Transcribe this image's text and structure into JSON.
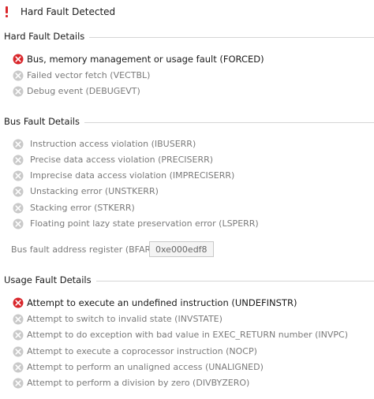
{
  "title": "Hard Fault Detected",
  "colors": {
    "error_red": "#d9262b",
    "disabled_gray": "#c9c9c9",
    "text_dark": "#1a1a1a",
    "text_gray": "#7a7a7a"
  },
  "sections": {
    "hard": {
      "title": "Hard Fault Details",
      "items": [
        {
          "label": "Bus, memory management or usage fault (FORCED)",
          "active": true,
          "icon": "error-icon"
        },
        {
          "label": "Failed vector fetch (VECTBL)",
          "active": false,
          "icon": "error-icon"
        },
        {
          "label": "Debug event (DEBUGEVT)",
          "active": false,
          "icon": "error-icon"
        }
      ]
    },
    "bus": {
      "title": "Bus Fault Details",
      "items": [
        {
          "label": "Instruction access violation (IBUSERR)",
          "active": false,
          "icon": "error-icon"
        },
        {
          "label": "Precise data access violation (PRECISERR)",
          "active": false,
          "icon": "error-icon"
        },
        {
          "label": "Imprecise data access violation (IMPRECISERR)",
          "active": false,
          "icon": "error-icon"
        },
        {
          "label": "Unstacking error (UNSTKERR)",
          "active": false,
          "icon": "error-icon"
        },
        {
          "label": "Stacking error (STKERR)",
          "active": false,
          "icon": "error-icon"
        },
        {
          "label": "Floating point lazy state preservation error (LSPERR)",
          "active": false,
          "icon": "error-icon"
        }
      ],
      "bfar_label": "Bus fault address register (BFAR):",
      "bfar_value": "0xe000edf8"
    },
    "usage": {
      "title": "Usage Fault Details",
      "items": [
        {
          "label": "Attempt to execute an undefined instruction (UNDEFINSTR)",
          "active": true,
          "icon": "error-icon"
        },
        {
          "label": "Attempt to switch to invalid state (INVSTATE)",
          "active": false,
          "icon": "error-icon"
        },
        {
          "label": "Attempt to do exception with bad value in EXEC_RETURN number (INVPC)",
          "active": false,
          "icon": "error-icon"
        },
        {
          "label": "Attempt to execute a coprocessor instruction (NOCP)",
          "active": false,
          "icon": "error-icon"
        },
        {
          "label": "Attempt to perform an unaligned access (UNALIGNED)",
          "active": false,
          "icon": "error-icon"
        },
        {
          "label": "Attempt to perform a division by zero (DIVBYZERO)",
          "active": false,
          "icon": "error-icon"
        }
      ]
    }
  }
}
